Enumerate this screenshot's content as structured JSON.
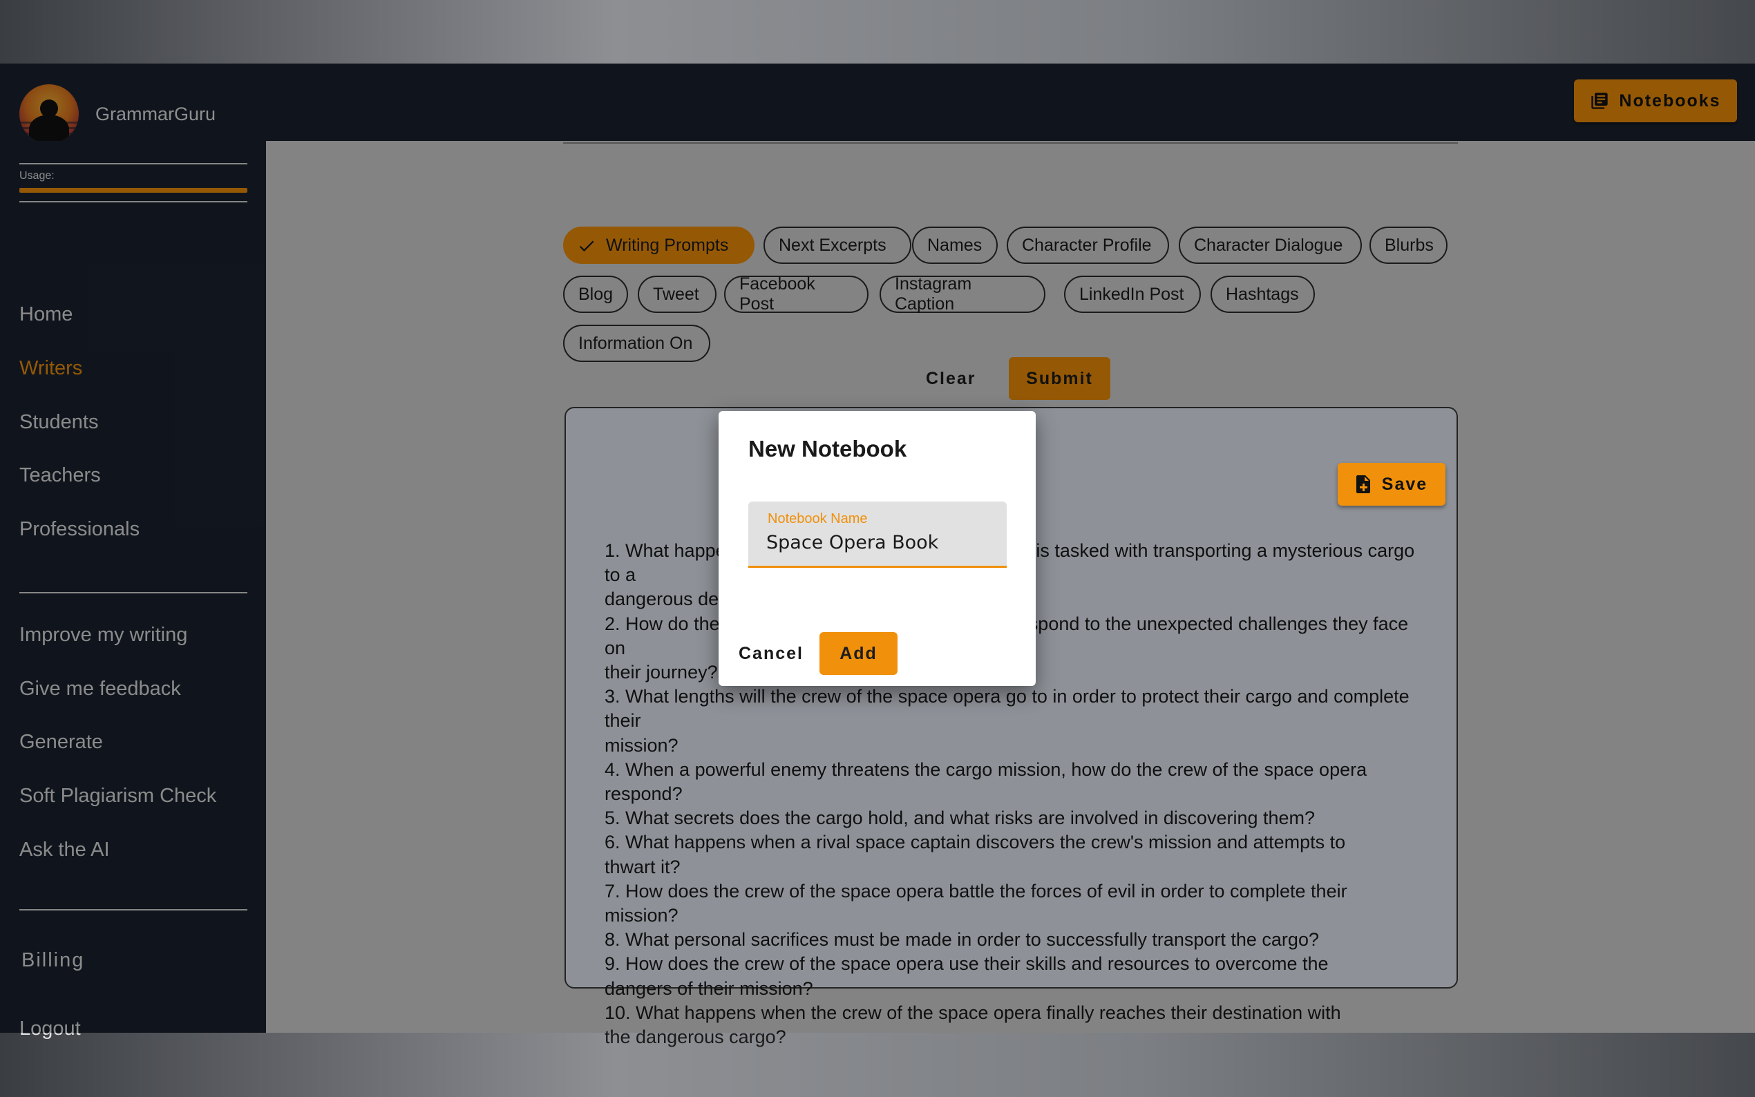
{
  "app": {
    "brand": "GrammarGuru",
    "logo_icon": "meditation-sunset-logo"
  },
  "header": {
    "notebooks_label": "Notebooks",
    "notebooks_icon": "notebook-icon"
  },
  "sidebar": {
    "usage_label": "Usage:",
    "usage_fraction": 1.0,
    "primary": [
      {
        "label": "Home",
        "active": false
      },
      {
        "label": "Writers",
        "active": true
      },
      {
        "label": "Students",
        "active": false
      },
      {
        "label": "Teachers",
        "active": false
      },
      {
        "label": "Professionals",
        "active": false
      }
    ],
    "tools": [
      {
        "label": "Improve my writing"
      },
      {
        "label": "Give me feedback"
      },
      {
        "label": "Generate"
      },
      {
        "label": "Soft Plagiarism Check"
      },
      {
        "label": "Ask the AI"
      }
    ],
    "billing": "Billing",
    "logout": "Logout"
  },
  "chips": [
    {
      "label": "Writing Prompts",
      "selected": true
    },
    {
      "label": "Next Excerpts",
      "selected": false
    },
    {
      "label": "Names",
      "selected": false
    },
    {
      "label": "Character Profile",
      "selected": false
    },
    {
      "label": "Character Dialogue",
      "selected": false
    },
    {
      "label": "Blurbs",
      "selected": false
    },
    {
      "label": "Blog",
      "selected": false
    },
    {
      "label": "Tweet",
      "selected": false
    },
    {
      "label": "Facebook Post",
      "selected": false
    },
    {
      "label": "Instagram Caption",
      "selected": false
    },
    {
      "label": "LinkedIn Post",
      "selected": false
    },
    {
      "label": "Hashtags",
      "selected": false
    },
    {
      "label": "Information On",
      "selected": false
    }
  ],
  "actions": {
    "clear": "Clear",
    "submit": "Submit",
    "save": "Save",
    "save_icon": "file-add-icon"
  },
  "output_lines": [
    "1. What happens when the crew of the space opera is tasked with transporting a mysterious cargo to a",
    "dangerous destination?",
    "2. How do the crew members of the space opera respond to the unexpected challenges they face on",
    "their journey?",
    "3. What lengths will the crew of the space opera go to in order to protect their cargo and complete their",
    "mission?",
    "4. When a powerful enemy threatens the cargo mission, how do the crew of the space opera",
    "respond?",
    "5. What secrets does the cargo hold, and what risks are involved in discovering them?",
    "6. What happens when a rival space captain discovers the crew's mission and attempts to",
    "thwart it?",
    "7. How does the crew of the space opera battle the forces of evil in order to complete their",
    "mission?",
    "8. What personal sacrifices must be made in order to successfully transport the cargo?",
    "9. How does the crew of the space opera use their skills and resources to overcome the",
    "dangers of their mission?",
    "10. What happens when the crew of the space opera finally reaches their destination with",
    "the dangerous cargo?"
  ],
  "dialog": {
    "title": "New Notebook",
    "field_label": "Notebook Name",
    "field_value": "Space Opera Book",
    "cancel": "Cancel",
    "add": "Add"
  },
  "colors": {
    "accent": "#f0900b",
    "sidebar_bg": "#1b2330",
    "active_nav": "#f0900b"
  }
}
